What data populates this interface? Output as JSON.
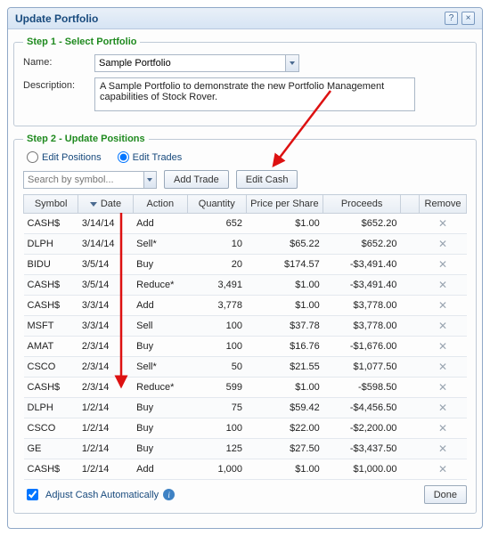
{
  "window": {
    "title": "Update Portfolio"
  },
  "step1": {
    "legend": "Step 1 - Select Portfolio",
    "name_label": "Name:",
    "name_value": "Sample Portfolio",
    "desc_label": "Description:",
    "desc_value": "A Sample Portfolio to demonstrate the new Portfolio Management capabilities of Stock Rover."
  },
  "step2": {
    "legend": "Step 2 - Update Positions",
    "radio_positions": "Edit Positions",
    "radio_trades": "Edit Trades",
    "search_placeholder": "Search by symbol...",
    "add_trade_btn": "Add Trade",
    "edit_cash_btn": "Edit Cash",
    "columns": {
      "symbol": "Symbol",
      "date": "Date",
      "action": "Action",
      "quantity": "Quantity",
      "pps": "Price per Share",
      "proceeds": "Proceeds",
      "remove": "Remove"
    },
    "rows": [
      {
        "sym": "CASH$",
        "date": "3/14/14",
        "action": "Add",
        "qty": "652",
        "pps": "$1.00",
        "proc": "$652.20"
      },
      {
        "sym": "DLPH",
        "date": "3/14/14",
        "action": "Sell*",
        "qty": "10",
        "pps": "$65.22",
        "proc": "$652.20"
      },
      {
        "sym": "BIDU",
        "date": "3/5/14",
        "action": "Buy",
        "qty": "20",
        "pps": "$174.57",
        "proc": "-$3,491.40"
      },
      {
        "sym": "CASH$",
        "date": "3/5/14",
        "action": "Reduce*",
        "qty": "3,491",
        "pps": "$1.00",
        "proc": "-$3,491.40"
      },
      {
        "sym": "CASH$",
        "date": "3/3/14",
        "action": "Add",
        "qty": "3,778",
        "pps": "$1.00",
        "proc": "$3,778.00"
      },
      {
        "sym": "MSFT",
        "date": "3/3/14",
        "action": "Sell",
        "qty": "100",
        "pps": "$37.78",
        "proc": "$3,778.00"
      },
      {
        "sym": "AMAT",
        "date": "2/3/14",
        "action": "Buy",
        "qty": "100",
        "pps": "$16.76",
        "proc": "-$1,676.00"
      },
      {
        "sym": "CSCO",
        "date": "2/3/14",
        "action": "Sell*",
        "qty": "50",
        "pps": "$21.55",
        "proc": "$1,077.50"
      },
      {
        "sym": "CASH$",
        "date": "2/3/14",
        "action": "Reduce*",
        "qty": "599",
        "pps": "$1.00",
        "proc": "-$598.50"
      },
      {
        "sym": "DLPH",
        "date": "1/2/14",
        "action": "Buy",
        "qty": "75",
        "pps": "$59.42",
        "proc": "-$4,456.50"
      },
      {
        "sym": "CSCO",
        "date": "1/2/14",
        "action": "Buy",
        "qty": "100",
        "pps": "$22.00",
        "proc": "-$2,200.00"
      },
      {
        "sym": "GE",
        "date": "1/2/14",
        "action": "Buy",
        "qty": "125",
        "pps": "$27.50",
        "proc": "-$3,437.50"
      },
      {
        "sym": "CASH$",
        "date": "1/2/14",
        "action": "Add",
        "qty": "1,000",
        "pps": "$1.00",
        "proc": "$1,000.00"
      }
    ],
    "adjust_cash_label": "Adjust Cash Automatically",
    "done_btn": "Done"
  }
}
